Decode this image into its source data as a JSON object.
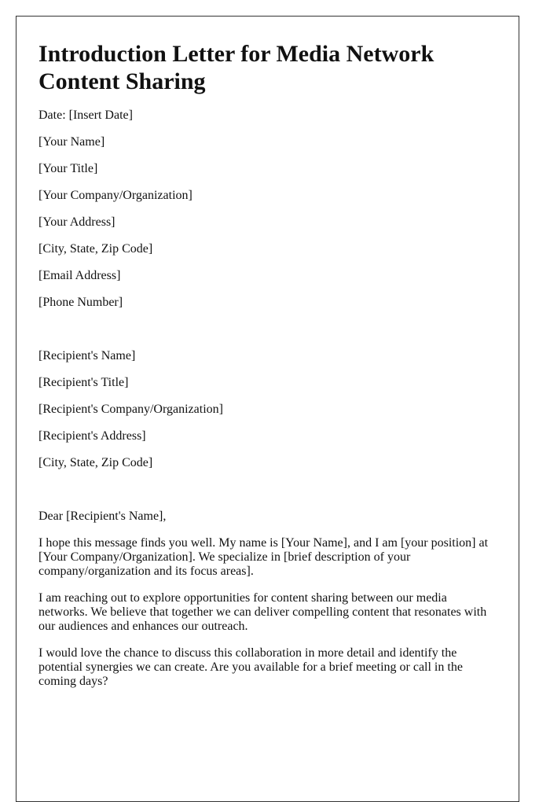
{
  "document": {
    "title": "Introduction Letter for Media Network Content Sharing",
    "date_line": "Date: [Insert Date]",
    "sender": [
      "[Your Name]",
      "[Your Title]",
      "[Your Company/Organization]",
      "[Your Address]",
      "[City, State, Zip Code]",
      "[Email Address]",
      "[Phone Number]"
    ],
    "recipient": [
      "[Recipient's Name]",
      "[Recipient's Title]",
      "[Recipient's Company/Organization]",
      "[Recipient's Address]",
      "[City, State, Zip Code]"
    ],
    "salutation": "Dear [Recipient's Name],",
    "body": [
      "I hope this message finds you well. My name is [Your Name], and I am [your position] at [Your Company/Organization]. We specialize in [brief description of your company/organization and its focus areas].",
      "I am reaching out to explore opportunities for content sharing between our media networks. We believe that together we can deliver compelling content that resonates with our audiences and enhances our outreach.",
      "I would love the chance to discuss this collaboration in more detail and identify the potential synergies we can create. Are you available for a brief meeting or call in the coming days?"
    ]
  }
}
